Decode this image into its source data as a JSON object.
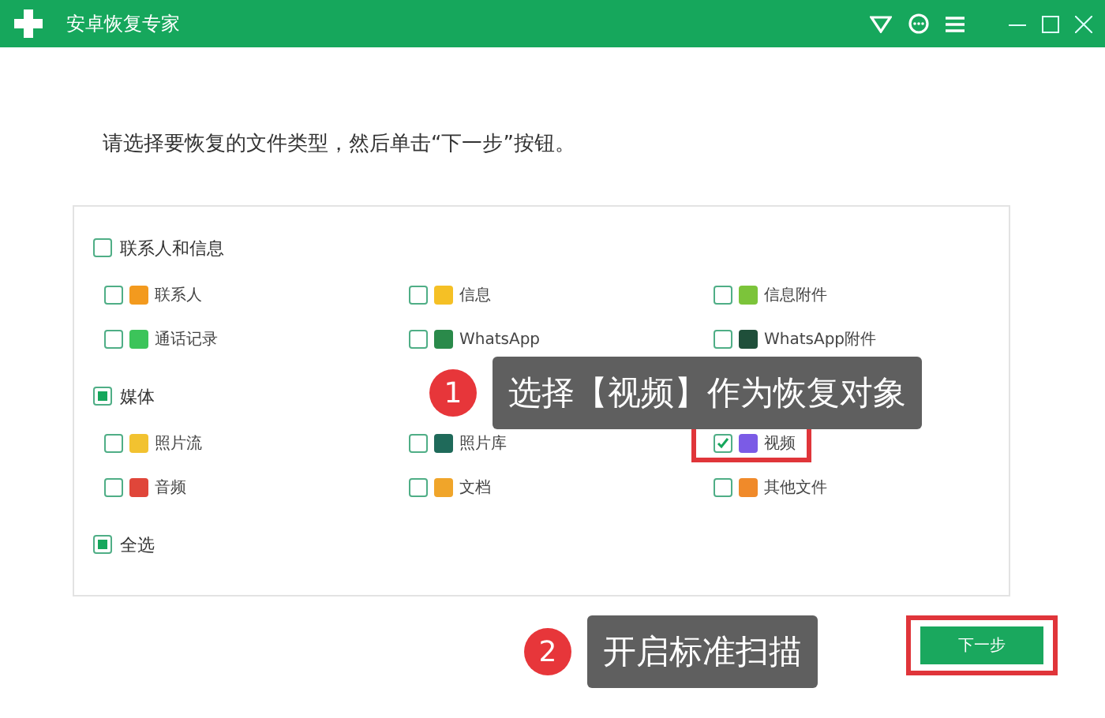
{
  "window": {
    "title": "安卓恢复专家"
  },
  "instruction": "请选择要恢复的文件类型，然后单击“下一步”按钮。",
  "sections": [
    {
      "label": "联系人和信息",
      "partial": false,
      "items": [
        {
          "label": "联系人",
          "checked": false,
          "color": "#f39a1e",
          "highlighted": false
        },
        {
          "label": "信息",
          "checked": false,
          "color": "#f5c025",
          "highlighted": false
        },
        {
          "label": "信息附件",
          "checked": false,
          "color": "#7cc43a",
          "highlighted": false
        },
        {
          "label": "通话记录",
          "checked": false,
          "color": "#3cc45a",
          "highlighted": false
        },
        {
          "label": "WhatsApp",
          "checked": false,
          "color": "#2a8a4a",
          "highlighted": false
        },
        {
          "label": "WhatsApp附件",
          "checked": false,
          "color": "#1f4f3a",
          "highlighted": false
        }
      ]
    },
    {
      "label": "媒体",
      "partial": true,
      "items": [
        {
          "label": "照片流",
          "checked": false,
          "color": "#f2c230",
          "highlighted": false
        },
        {
          "label": "照片库",
          "checked": false,
          "color": "#1f6a5a",
          "highlighted": false
        },
        {
          "label": "视频",
          "checked": true,
          "color": "#7b5be6",
          "highlighted": true
        },
        {
          "label": "音频",
          "checked": false,
          "color": "#e0463a",
          "highlighted": false
        },
        {
          "label": "文档",
          "checked": false,
          "color": "#f0a52a",
          "highlighted": false
        },
        {
          "label": "其他文件",
          "checked": false,
          "color": "#f08a2a",
          "highlighted": false
        }
      ]
    }
  ],
  "select_all": {
    "label": "全选",
    "partial": true
  },
  "next_button": {
    "label": "下一步",
    "highlighted": true
  },
  "callouts": [
    {
      "number": "1",
      "text": "选择【视频】作为恢复对象"
    },
    {
      "number": "2",
      "text": "开启标准扫描"
    }
  ]
}
